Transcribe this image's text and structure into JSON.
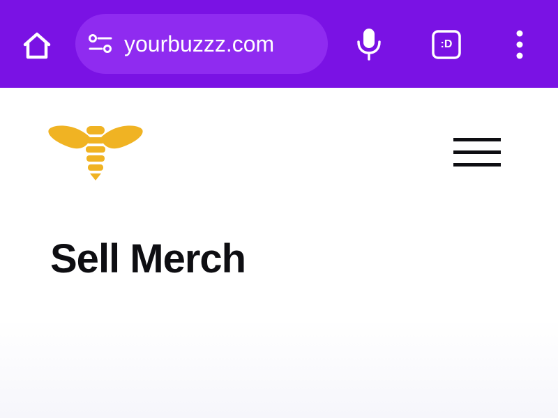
{
  "browser": {
    "toolbar_color": "#7a12e4",
    "url_pill_color": "#8f2bf0",
    "url": "yourbuzzz.com",
    "tab_count_label": ":D",
    "icons": {
      "home": "home-icon",
      "site_settings": "tune-icon",
      "voice": "microphone-icon",
      "tabs": "tab-switcher-icon",
      "menu": "more-vertical-icon"
    }
  },
  "site": {
    "brand_color": "#f0b323",
    "logo_icon": "bee-logo-icon",
    "menu_icon": "hamburger-icon",
    "heading": "Sell Merch"
  }
}
